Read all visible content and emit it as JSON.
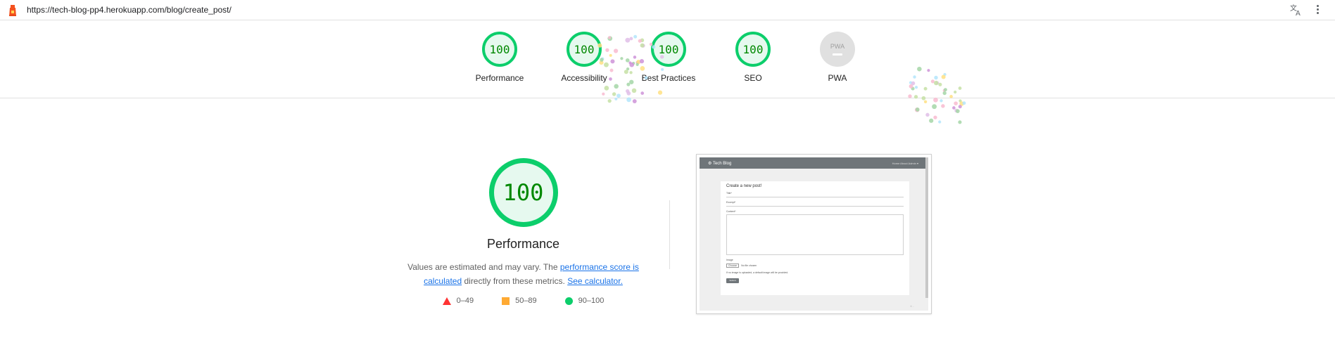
{
  "browser": {
    "url": "https://tech-blog-pp4.herokuapp.com/blog/create_post/",
    "icons": [
      "lighthouse-icon",
      "translate-icon",
      "more-vert-icon"
    ]
  },
  "gauges": [
    {
      "score": "100",
      "label": "Performance"
    },
    {
      "score": "100",
      "label": "Accessibility"
    },
    {
      "score": "100",
      "label": "Best Practices"
    },
    {
      "score": "100",
      "label": "SEO"
    },
    {
      "score": "PWA",
      "label": "PWA"
    }
  ],
  "performance": {
    "score": "100",
    "title": "Performance",
    "desc_before": "Values are estimated and may vary. The ",
    "desc_link1": "performance score is calculated",
    "desc_middle": " directly from these metrics. ",
    "desc_link2": "See calculator.",
    "legend": [
      {
        "range": "0–49",
        "color": "#ff3333",
        "shape": "triangle"
      },
      {
        "range": "50–89",
        "color": "#ffaa33",
        "shape": "square"
      },
      {
        "range": "90–100",
        "color": "#0cce6b",
        "shape": "circle"
      }
    ]
  },
  "screenshot": {
    "brand": "⚙ Tech Blog",
    "nav_links": "Home  About  Admin ▾",
    "heading": "Create a new post!",
    "title_label": "Title*",
    "excerpt_label": "Excerpt*",
    "content_label": "Content*",
    "image_label": "Image",
    "file_button": "Choose",
    "file_status": "No file chosen",
    "image_help": "If no image is uploaded, a default image will be provided.",
    "submit": "Submit",
    "footer": "© ..."
  },
  "colors": {
    "pass": "#0cce6b",
    "pass_text": "#008800",
    "pass_bg": "#e6f9ef",
    "link": "#1a73e8"
  }
}
